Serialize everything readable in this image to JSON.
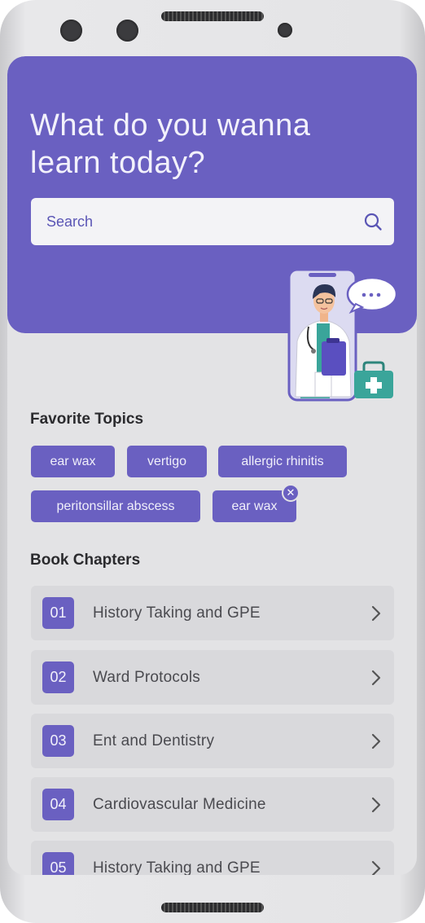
{
  "hero": {
    "title_line1": "What do you wanna",
    "title_line2": "learn today?"
  },
  "search": {
    "placeholder": "Search",
    "icon": "search-icon"
  },
  "favorites": {
    "title": "Favorite Topics",
    "chips": [
      {
        "label": "ear wax"
      },
      {
        "label": "vertigo"
      },
      {
        "label": "allergic rhinitis"
      },
      {
        "label": "peritonsillar abscess"
      },
      {
        "label": "ear wax",
        "removable": true
      }
    ]
  },
  "chapters": {
    "title": "Book Chapters",
    "items": [
      {
        "num": "01",
        "label": "History Taking and GPE"
      },
      {
        "num": "02",
        "label": "Ward Protocols"
      },
      {
        "num": "03",
        "label": "Ent and Dentistry"
      },
      {
        "num": "04",
        "label": "Cardiovascular Medicine"
      },
      {
        "num": "05",
        "label": "History Taking and GPE"
      }
    ]
  },
  "colors": {
    "accent": "#6a60c1",
    "screen_bg": "#e3e3e5",
    "card_bg": "#d9d9dc"
  }
}
